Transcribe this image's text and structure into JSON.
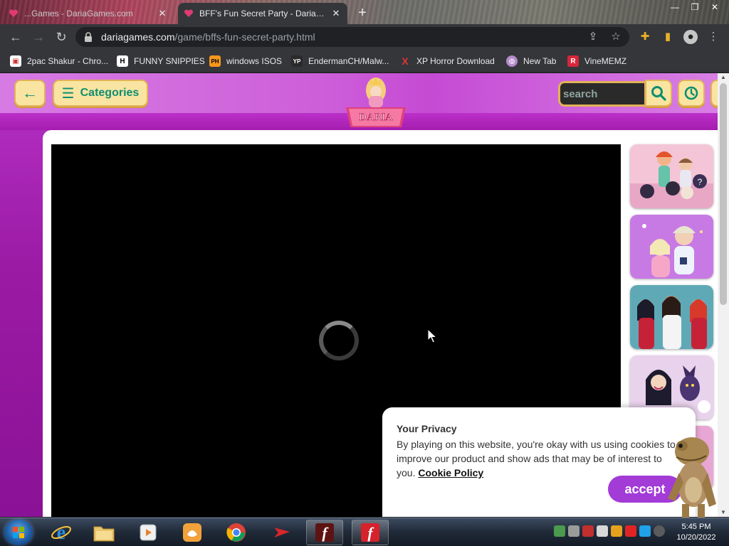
{
  "browser": {
    "tabs": [
      {
        "title": "...Games - DariaGames.com",
        "active": false
      },
      {
        "title": "BFF's Fun Secret Party - DariaGames",
        "active": true
      }
    ],
    "new_tab_label": "+",
    "window_controls": {
      "minimize": "—",
      "restore": "❐",
      "close": "✕"
    },
    "url_host": "dariagames.com",
    "url_path": "/game/bffs-fun-secret-party.html",
    "bookmarks": [
      {
        "label": "2pac Shakur - Chro...",
        "icon": "folder-icon",
        "glyph": "▣",
        "color": "#c33"
      },
      {
        "label": "FUNNY SNIPPIES",
        "icon": "h-icon",
        "glyph": "H",
        "color": "#fff"
      },
      {
        "label": "windows ISOS",
        "icon": "ph-icon",
        "glyph": "PH",
        "color": "#f7971d"
      },
      {
        "label": "EndermanCH/Malw...",
        "icon": "yp-icon",
        "glyph": "YP",
        "color": "#333"
      },
      {
        "label": "XP Horror Download",
        "icon": "x-icon",
        "glyph": "X",
        "color": "#e03333"
      },
      {
        "label": "New Tab",
        "icon": "globe-icon",
        "glyph": "◍",
        "color": "#b38acb"
      },
      {
        "label": "VineMEMZ",
        "icon": "r-icon",
        "glyph": "R",
        "color": "#d9263a"
      }
    ]
  },
  "site": {
    "categories_label": "Categories",
    "logo_text": "DARIA",
    "search_placeholder": "search",
    "accent": "#c03bd0",
    "button_color": "#f9e4a1",
    "icon_color": "#0e8e72"
  },
  "game": {
    "state": "loading"
  },
  "related_games": [
    {
      "name": "pets-thumbnail"
    },
    {
      "name": "couple-thumbnail"
    },
    {
      "name": "princesses-thumbnail"
    },
    {
      "name": "girl-cat-thumbnail"
    }
  ],
  "cookie": {
    "title": "Your Privacy",
    "text": "By playing on this website, you're okay with us using cookies to improve our product and show ads that may be of interest to you.",
    "link": "Cookie Policy",
    "accept": "accept"
  },
  "taskbar": {
    "time": "5:45 PM",
    "date": "10/20/2022"
  }
}
